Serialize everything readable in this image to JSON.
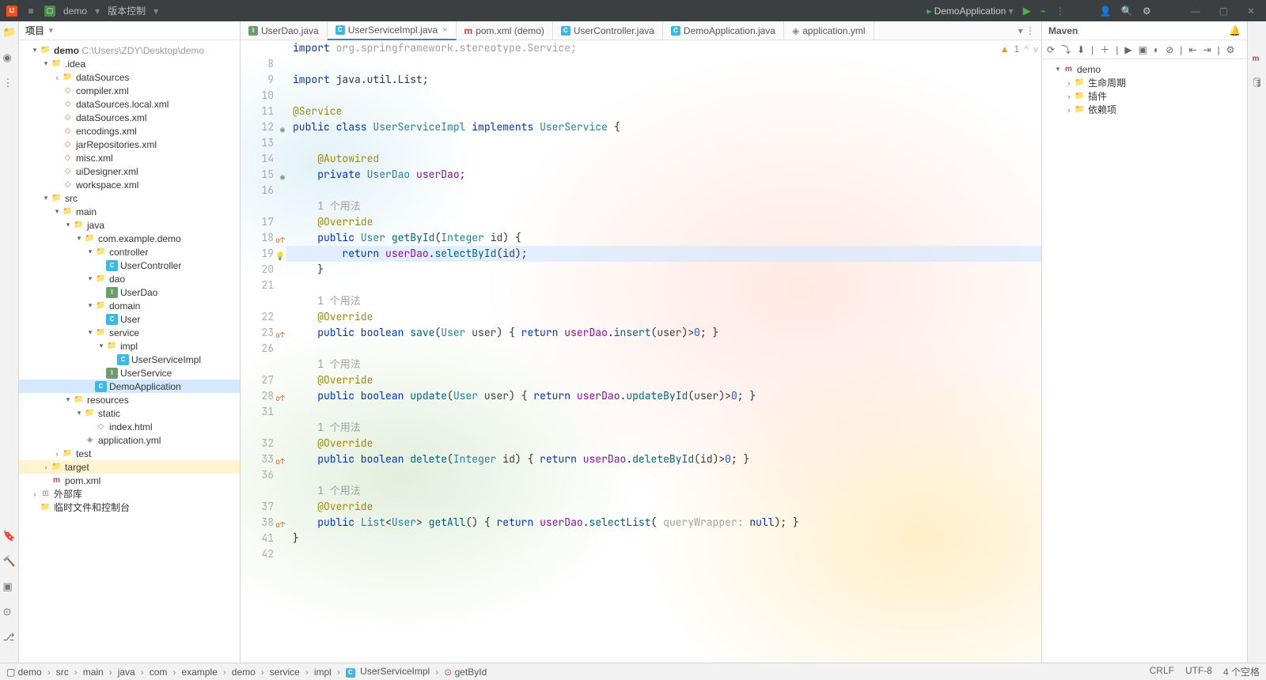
{
  "titlebar": {
    "project": "demo",
    "vcs": "版本控制",
    "run_config": "DemoApplication"
  },
  "project_panel": {
    "title": "项目",
    "root_name": "demo",
    "root_path": "C:\\Users\\ZDY\\Desktop\\demo",
    "libs": "外部库",
    "scratches": "临时文件和控制台"
  },
  "tree": {
    "idea": ".idea",
    "dataSources": "dataSources",
    "compiler": "compiler.xml",
    "dataSourcesLocal": "dataSources.local.xml",
    "dataSourcesXml": "dataSources.xml",
    "encodings": "encodings.xml",
    "jarRepos": "jarRepositories.xml",
    "misc": "misc.xml",
    "uiDesigner": "uiDesigner.xml",
    "workspace": "workspace.xml",
    "src": "src",
    "main": "main",
    "java": "java",
    "pkg": "com.example.demo",
    "controller": "controller",
    "userController": "UserController",
    "dao": "dao",
    "userDao": "UserDao",
    "domain": "domain",
    "user": "User",
    "service": "service",
    "impl": "impl",
    "userServiceImpl": "UserServiceImpl",
    "userService": "UserService",
    "demoApp": "DemoApplication",
    "resources": "resources",
    "static": "static",
    "indexHtml": "index.html",
    "appYml": "application.yml",
    "test": "test",
    "target": "target",
    "pom": "pom.xml"
  },
  "tabs": [
    {
      "icon": "I",
      "label": "UserDao.java",
      "active": false,
      "iconClass": "int-i"
    },
    {
      "icon": "C",
      "label": "UserServiceImpl.java",
      "active": true,
      "iconClass": "cls-i"
    },
    {
      "icon": "m",
      "label": "pom.xml (demo)",
      "active": false,
      "iconClass": "mvn"
    },
    {
      "icon": "C",
      "label": "UserController.java",
      "active": false,
      "iconClass": "cls-i"
    },
    {
      "icon": "C",
      "label": "DemoApplication.java",
      "active": false,
      "iconClass": "cls-i"
    },
    {
      "icon": "·",
      "label": "application.yml",
      "active": false,
      "iconClass": "yml"
    }
  ],
  "code": {
    "hint_import": "import org.springframework.stereotype.Service;",
    "line9": "import java.util.List;",
    "usages": "1 个用法",
    "inspection_count": "1"
  },
  "maven": {
    "title": "Maven",
    "root": "demo",
    "lifecycle": "生命周期",
    "plugins": "插件",
    "deps": "依赖项"
  },
  "breadcrumbs": [
    "demo",
    "src",
    "main",
    "java",
    "com",
    "example",
    "demo",
    "service",
    "impl",
    "UserServiceImpl",
    "getById"
  ],
  "status": {
    "line_sep": "CRLF",
    "encoding": "UTF-8",
    "spaces": "4 个空格"
  }
}
